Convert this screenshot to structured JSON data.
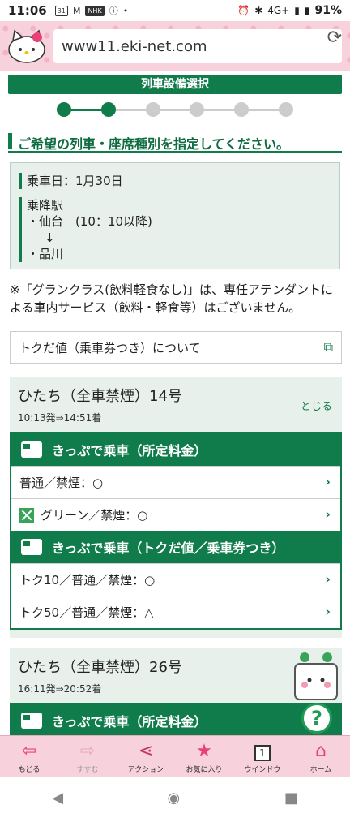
{
  "status": {
    "time": "11:06",
    "calendar": "31",
    "m_icon": "M",
    "nhk": "NHK",
    "network": "4G+",
    "battery": "91%"
  },
  "browser": {
    "url": "www11.eki-net.com"
  },
  "page": {
    "header": "列車設備選択",
    "steps_total": 6,
    "steps_current": 2,
    "title": "ご希望の列車・座席種別を指定してください。",
    "ride_date": "乗車日：1月30日",
    "stations_label": "乗降駅",
    "from": "・仙台　(10：10以降)",
    "arrow": "↓",
    "to": "・品川",
    "note": "※「グランクラス(飲料軽食なし)」は、専任アテンダントによる車内サービス（飲料・軽食等）はございません。",
    "toku_link": "トクだ値（乗車券つき）について"
  },
  "trains": [
    {
      "name": "ひたち（全車禁煙）14号",
      "time": "10:13発⇒14:51着",
      "close": "とじる",
      "sections": [
        {
          "heading": "きっぷで乗車（所定料金）",
          "rows": [
            "普通／禁煙：○",
            "グリーン／禁煙：○"
          ]
        },
        {
          "heading": "きっぷで乗車（トクだ値／乗車券つき）",
          "rows": [
            "トク10／普通／禁煙：○",
            "トク50／普通／禁煙：△"
          ]
        }
      ]
    },
    {
      "name": "ひたち（全車禁煙）26号",
      "time": "16:11発⇒20:52着",
      "sections": [
        {
          "heading": "きっぷで乗車（所定料金）"
        }
      ]
    }
  ],
  "help": "?",
  "toolbar": [
    {
      "label": "もどる",
      "icon": "back-arrow-icon"
    },
    {
      "label": "すすむ",
      "icon": "forward-arrow-icon"
    },
    {
      "label": "アクション",
      "icon": "share-icon"
    },
    {
      "label": "お気に入り",
      "icon": "star-icon"
    },
    {
      "label": "ウインドウ",
      "icon": "window-icon",
      "count": "1"
    },
    {
      "label": "ホーム",
      "icon": "home-icon"
    }
  ],
  "colors": {
    "primary": "#107c4c",
    "pink": "#f7d2dc",
    "inactive": "#cccccc"
  }
}
